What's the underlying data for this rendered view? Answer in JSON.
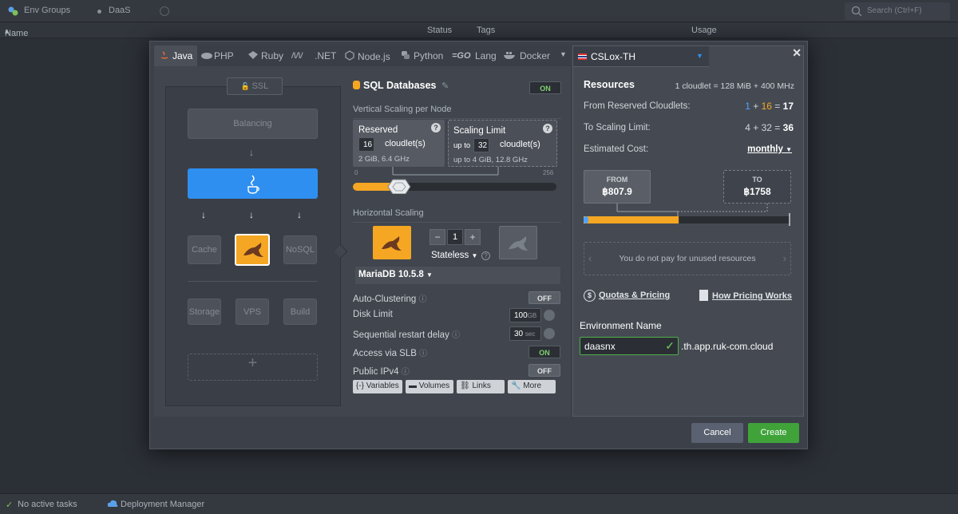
{
  "background": {
    "tabs": [
      "Env Groups",
      "DaaS"
    ],
    "search_placeholder": "Search (Ctrl+F)",
    "columns": [
      "Name",
      "Status",
      "Tags",
      "Usage"
    ],
    "status_left": "No active tasks",
    "status_right": "Deployment Manager"
  },
  "tabs": [
    {
      "label": "Java"
    },
    {
      "label": "PHP"
    },
    {
      "label": "Ruby"
    },
    {
      "label": ".NET"
    },
    {
      "label": "Node.js"
    },
    {
      "label": "Python"
    },
    {
      "label": "Lang"
    },
    {
      "label": "Docker"
    }
  ],
  "region": {
    "label": "CSLox-TH"
  },
  "topology": {
    "ssl": "SSL",
    "balancing": "Balancing",
    "cache": "Cache",
    "nosql": "NoSQL",
    "storage": "Storage",
    "vps": "VPS",
    "build": "Build",
    "add": "+"
  },
  "sql": {
    "title": "SQL Databases",
    "toggle": "ON",
    "vertical_title": "Vertical Scaling per Node",
    "reserved": {
      "title": "Reserved",
      "value": "16",
      "unit": "cloudlet(s)",
      "desc": "2 GiB, 6.4 GHz"
    },
    "limit": {
      "title": "Scaling Limit",
      "prefix": "up to",
      "value": "32",
      "unit": "cloudlet(s)",
      "desc": "up to 4 GiB, 12.8 GHz"
    },
    "slider_min": "0",
    "slider_max": "256",
    "slider_reserved": 16,
    "slider_limit": 32,
    "slider_total": 256,
    "horizontal_title": "Horizontal Scaling",
    "count": "1",
    "minus": "−",
    "plus": "+",
    "mode": "Stateless",
    "version": "MariaDB 10.5.8",
    "options": [
      {
        "label": "Auto-Clustering",
        "state": "OFF"
      },
      {
        "label": "Disk Limit",
        "value": "100",
        "unit": "GB"
      },
      {
        "label": "Sequential restart delay",
        "value": "30",
        "unit": "sec"
      },
      {
        "label": "Access via SLB",
        "state": "ON"
      },
      {
        "label": "Public IPv4",
        "state": "OFF"
      }
    ],
    "actions": [
      "Variables",
      "Volumes",
      "Links",
      "More"
    ]
  },
  "resources": {
    "title": "Resources",
    "cloudlet_def": "1 cloudlet = 128 MiB + 400 MHz",
    "reserved_label": "From Reserved Cloudlets:",
    "reserved_a": "1",
    "reserved_b": "16",
    "reserved_sum": "17",
    "limit_label": "To Scaling Limit:",
    "limit_a": "4",
    "limit_b": "32",
    "limit_sum": "36",
    "cost_label": "Estimated Cost:",
    "period": "monthly",
    "from_label": "FROM",
    "from_value": "฿807.9",
    "to_label": "TO",
    "to_value": "฿1758",
    "cost_fill_fraction": 0.46,
    "note": "You do not pay for unused resources",
    "quotas": "Quotas & Pricing",
    "how": "How Pricing Works",
    "env_label": "Environment Name",
    "env_value": "daasnx",
    "env_suffix": ".th.app.ruk-com.cloud"
  },
  "buttons": {
    "cancel": "Cancel",
    "create": "Create"
  },
  "colors": {
    "accent_blue": "#2f8ff0",
    "accent_orange": "#f5a623",
    "create_green": "#3fa33a"
  }
}
